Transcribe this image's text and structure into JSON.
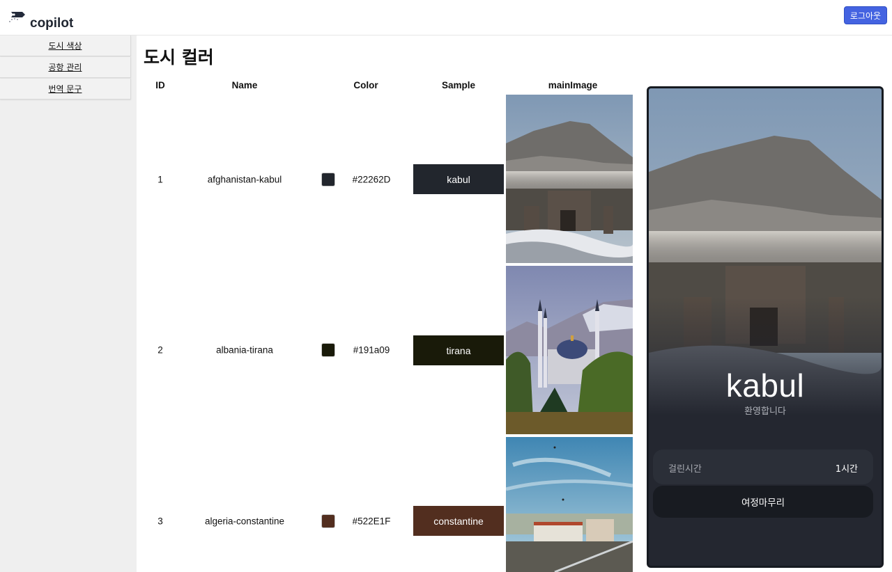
{
  "app": {
    "logo_text": "copilot",
    "logout_label": "로그아웃"
  },
  "sidebar": {
    "items": [
      {
        "label": "도시 색상"
      },
      {
        "label": "공항 관리"
      },
      {
        "label": "번역 문구"
      }
    ]
  },
  "page": {
    "title": "도시 컬러"
  },
  "table": {
    "headers": {
      "id": "ID",
      "name": "Name",
      "color": "Color",
      "sample": "Sample",
      "main_image": "mainImage"
    },
    "rows": [
      {
        "id": "1",
        "name": "afghanistan-kabul",
        "color": "#22262D",
        "sample": "kabul",
        "swatch": "#22262D",
        "image": "mountain-ruins"
      },
      {
        "id": "2",
        "name": "albania-tirana",
        "color": "#191a09",
        "sample": "tirana",
        "swatch": "#191a09",
        "image": "mosque-mountains"
      },
      {
        "id": "3",
        "name": "algeria-constantine",
        "color": "#522E1F",
        "sample": "constantine",
        "swatch": "#522E1F",
        "image": "city-sky"
      }
    ]
  },
  "preview": {
    "city": "kabul",
    "welcome": "환영합니다",
    "duration_label": "걸린시간",
    "duration_value": "1시간",
    "finish_label": "여정마무리",
    "background_color": "#22262D"
  },
  "colors": {
    "accent": "#4463e1"
  }
}
